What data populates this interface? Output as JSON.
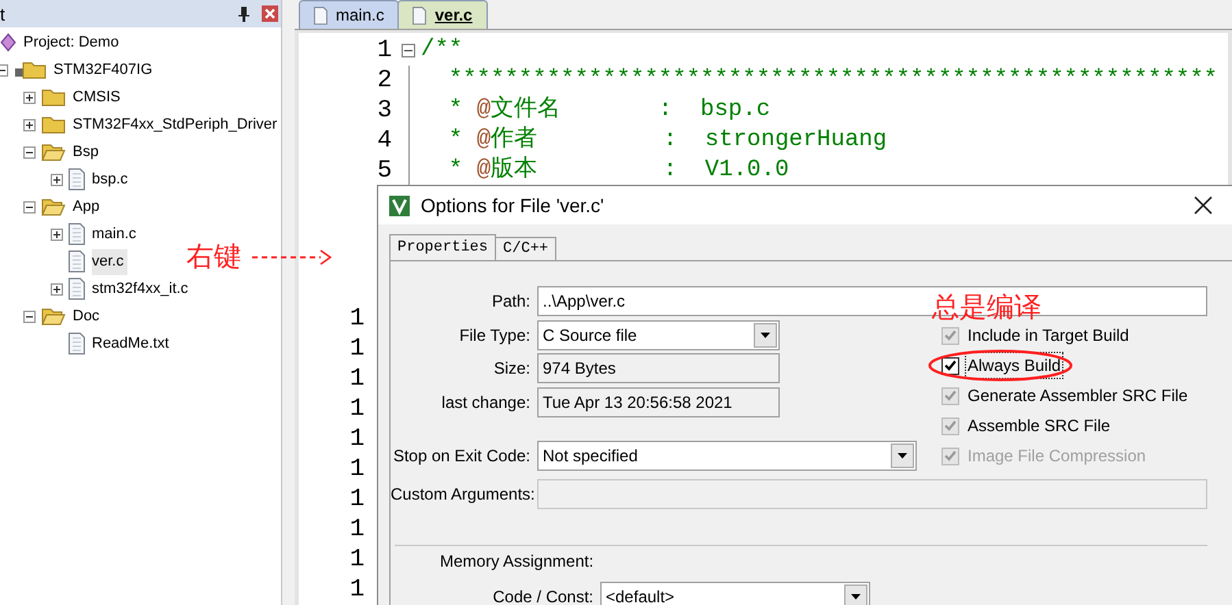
{
  "project_panel": {
    "title": "t"
  },
  "tree": [
    {
      "label": "Project: Demo",
      "kind": "project",
      "selected": false,
      "children": [
        {
          "label": "STM32F407IG",
          "kind": "target",
          "expanded": true,
          "selected": false,
          "children": [
            {
              "label": "CMSIS",
              "kind": "folder",
              "expanded": false,
              "selected": false
            },
            {
              "label": "STM32F4xx_StdPeriph_Driver",
              "kind": "folder",
              "expanded": false,
              "selected": false
            },
            {
              "label": "Bsp",
              "kind": "folder",
              "expanded": true,
              "selected": false,
              "children": [
                {
                  "label": "bsp.c",
                  "kind": "file",
                  "expanded": false,
                  "selected": false
                }
              ]
            },
            {
              "label": "App",
              "kind": "folder",
              "expanded": true,
              "selected": false,
              "children": [
                {
                  "label": "main.c",
                  "kind": "file",
                  "expanded": false,
                  "selected": false
                },
                {
                  "label": "ver.c",
                  "kind": "leaf",
                  "selected": true
                },
                {
                  "label": "stm32f4xx_it.c",
                  "kind": "file",
                  "expanded": false,
                  "selected": false
                }
              ]
            },
            {
              "label": "Doc",
              "kind": "folder",
              "expanded": true,
              "selected": false,
              "children": [
                {
                  "label": "ReadMe.txt",
                  "kind": "leaf",
                  "selected": false
                }
              ]
            }
          ]
        }
      ]
    }
  ],
  "right_click_note": "右键",
  "editor_tabs": [
    {
      "label": "main.c",
      "selected": false
    },
    {
      "label": "ver.c",
      "selected": true
    }
  ],
  "code_lines": [
    {
      "number": "1",
      "fold": true,
      "parts": [
        {
          "kind": "comment",
          "text": "/**"
        }
      ]
    },
    {
      "number": "2",
      "fold": false,
      "parts": [
        {
          "kind": "comment",
          "text": "  *******************************************************"
        }
      ]
    },
    {
      "number": "3",
      "fold": false,
      "parts": [
        {
          "kind": "comment",
          "text": "  * "
        },
        {
          "kind": "doc_tag",
          "text": "@"
        },
        {
          "kind": "comment",
          "text": "文件名       :  bsp.c"
        }
      ]
    },
    {
      "number": "4",
      "fold": false,
      "parts": [
        {
          "kind": "comment",
          "text": "  * "
        },
        {
          "kind": "doc_tag",
          "text": "@"
        },
        {
          "kind": "comment",
          "text": "作者         :  strongerHuang"
        }
      ]
    },
    {
      "number": "5",
      "fold": false,
      "parts": [
        {
          "kind": "comment",
          "text": "  * "
        },
        {
          "kind": "doc_tag",
          "text": "@"
        },
        {
          "kind": "comment",
          "text": "版本         :  V1.0.0"
        }
      ]
    }
  ],
  "hidden_line_numbers": [
    "1",
    "1",
    "1",
    "1",
    "1",
    "1",
    "1",
    "1",
    "1",
    "1"
  ],
  "dialog": {
    "title": "Options for File 'ver.c'",
    "tabs": [
      {
        "label": "Properties",
        "selected": true
      },
      {
        "label": "C/C++",
        "selected": false
      }
    ],
    "path": {
      "label": "Path:",
      "value": "..\\App\\ver.c"
    },
    "file_type": {
      "label": "File Type:",
      "value": "C Source file"
    },
    "size": {
      "label": "Size:",
      "value": "974 Bytes"
    },
    "last_change": {
      "label": "last change:",
      "value": "Tue Apr 13 20:56:58 2021"
    },
    "stop_on_exit_code": {
      "label": "Stop on Exit Code:",
      "value": "Not specified"
    },
    "custom_arguments": {
      "label": "Custom Arguments:",
      "disabled": true
    },
    "note": "总是编译",
    "options": [
      {
        "label": "Include in Target Build",
        "checked": true,
        "inherited": true,
        "disabled": false,
        "highlighted": false
      },
      {
        "label": "Always Build",
        "checked": true,
        "inherited": false,
        "disabled": false,
        "highlighted": true
      },
      {
        "label": "Generate Assembler SRC File",
        "checked": true,
        "inherited": true,
        "disabled": false,
        "highlighted": false
      },
      {
        "label": "Assemble SRC File",
        "checked": true,
        "inherited": true,
        "disabled": false,
        "highlighted": false
      },
      {
        "label": "Image File Compression",
        "checked": true,
        "inherited": true,
        "disabled": true,
        "highlighted": false
      }
    ],
    "memory_assignment": {
      "label": "Memory Assignment:"
    },
    "code_const": {
      "label": "Code / Const:",
      "value": "<default>"
    }
  }
}
